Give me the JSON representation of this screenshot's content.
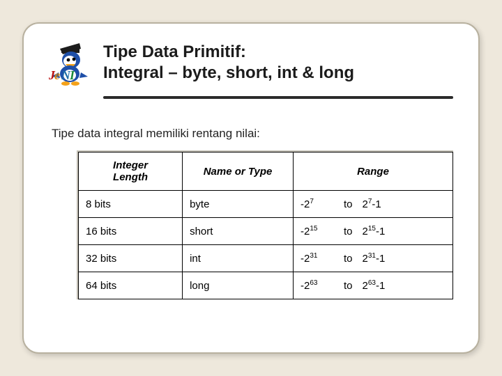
{
  "chart_data": {
    "type": "table",
    "title": "Tipe Data Primitif: Integral – byte, short, int & long",
    "columns": [
      "Integer Length",
      "Name or Type",
      "Range"
    ],
    "rows": [
      {
        "length": "8 bits",
        "type": "byte",
        "exp": 7,
        "range_text": "-2^7 to 2^7-1"
      },
      {
        "length": "16 bits",
        "type": "short",
        "exp": 15,
        "range_text": "-2^15 to 2^15-1"
      },
      {
        "length": "32 bits",
        "type": "int",
        "exp": 31,
        "range_text": "-2^31 to 2^31-1"
      },
      {
        "length": "64 bits",
        "type": "long",
        "exp": 63,
        "range_text": "-2^63 to 2^63-1"
      }
    ]
  },
  "logo_text": "JeNI",
  "title_line1": "Tipe Data Primitif:",
  "title_line2": "Integral – byte, short, int & long",
  "subtitle": "Tipe data integral memiliki rentang nilai:",
  "table": {
    "headers": {
      "h1a": "Integer",
      "h1b": "Length",
      "h2": "Name or Type",
      "h3": "Range"
    },
    "to_label": "to",
    "rows": [
      {
        "len": "8 bits",
        "type": "byte",
        "exp": "7"
      },
      {
        "len": "16 bits",
        "type": "short",
        "exp": "15"
      },
      {
        "len": "32 bits",
        "type": "int",
        "exp": "31"
      },
      {
        "len": "64 bits",
        "type": "long",
        "exp": "63"
      }
    ]
  }
}
